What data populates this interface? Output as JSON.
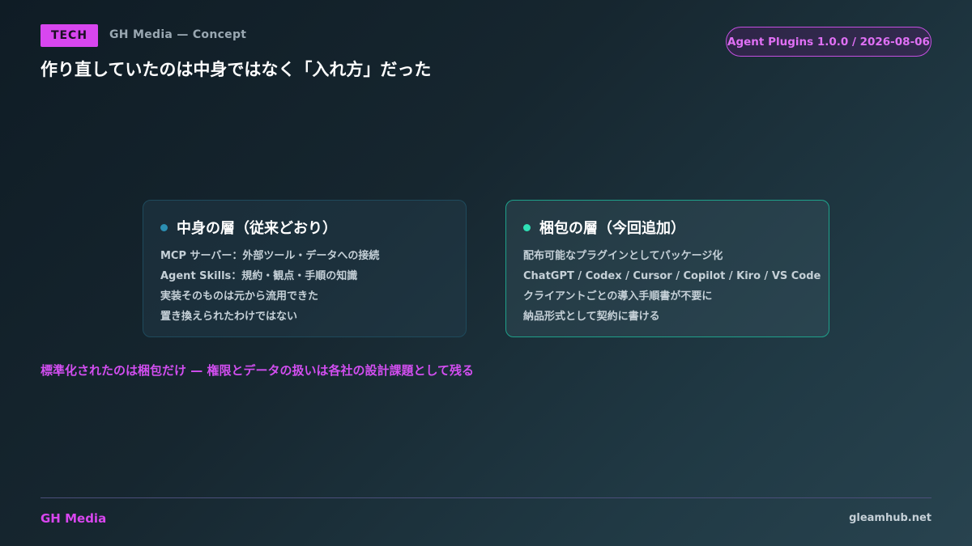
{
  "header": {
    "tag": "TECH",
    "brand_concept": "GH Media — Concept",
    "version": "Agent Plugins 1.0.0 / 2026-08-06",
    "title": "作り直していたのは中身ではなく「入れ方」だった"
  },
  "cards": {
    "left": {
      "heading": "中身の層（従来どおり）",
      "lines": [
        "MCP サーバー：外部ツール・データへの接続",
        "Agent Skills：規約・観点・手順の知識",
        "実装そのものは元から流用できた",
        "置き換えられたわけではない"
      ]
    },
    "right": {
      "heading": "梱包の層（今回追加）",
      "lines": [
        "配布可能なプラグインとしてパッケージ化",
        "ChatGPT / Codex / Cursor / Copilot / Kiro / VS Code",
        "クライアントごとの導入手順書が不要に",
        "納品形式として契約に書ける"
      ]
    }
  },
  "summary": "標準化されたのは梱包だけ — 権限とデータの扱いは各社の設計課題として残る",
  "footer": {
    "brand": "GH Media",
    "site": "gleamhub.net"
  },
  "colors": {
    "accent": "#d846ef",
    "teal": "#2fe0b5",
    "blue_dot": "#2b8fb3"
  }
}
